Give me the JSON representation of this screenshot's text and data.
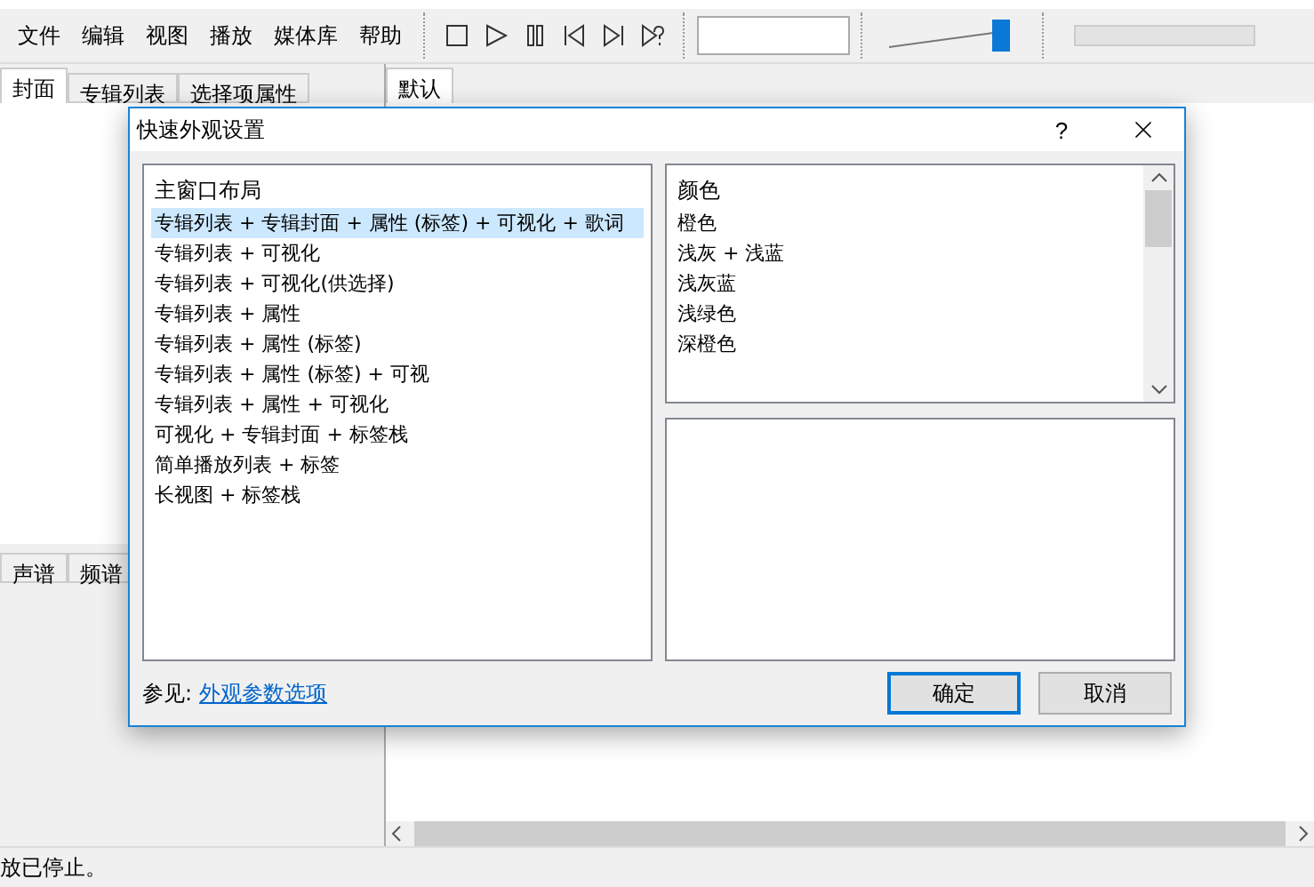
{
  "menu": [
    "文件",
    "编辑",
    "视图",
    "播放",
    "媒体库",
    "帮助"
  ],
  "volume": {
    "level": 0.93
  },
  "left_tabs": [
    {
      "label": "封面",
      "selected": true
    },
    {
      "label": "专辑列表",
      "selected": false
    },
    {
      "label": "选择项属性",
      "selected": false
    }
  ],
  "right_tabs": [
    {
      "label": "默认",
      "selected": true
    }
  ],
  "visual_tabs": [
    {
      "label": "声谱",
      "selected": false
    },
    {
      "label": "频谱",
      "selected": false
    }
  ],
  "status_bar": "放已停止。",
  "dialog": {
    "title": "快速外观设置",
    "help": "?",
    "layouts": {
      "heading": "主窗口布局",
      "items": [
        {
          "label": "专辑列表 + 专辑封面 + 属性 (标签) + 可视化 + 歌词",
          "selected": true
        },
        {
          "label": "专辑列表 + 可视化",
          "selected": false
        },
        {
          "label": "专辑列表 + 可视化(供选择)",
          "selected": false
        },
        {
          "label": "专辑列表 + 属性",
          "selected": false
        },
        {
          "label": "专辑列表 + 属性 (标签)",
          "selected": false
        },
        {
          "label": "专辑列表 + 属性 (标签) + 可视",
          "selected": false
        },
        {
          "label": "专辑列表 + 属性 + 可视化",
          "selected": false
        },
        {
          "label": "可视化 + 专辑封面 + 标签栈",
          "selected": false
        },
        {
          "label": "简单播放列表 + 标签",
          "selected": false
        },
        {
          "label": "长视图 + 标签栈",
          "selected": false
        }
      ]
    },
    "colors": {
      "heading": "颜色",
      "items": [
        {
          "label": "橙色",
          "selected": false
        },
        {
          "label": "浅灰 + 浅蓝",
          "selected": false
        },
        {
          "label": "浅灰蓝",
          "selected": false
        },
        {
          "label": "浅绿色",
          "selected": false
        },
        {
          "label": "深橙色",
          "selected": false
        }
      ]
    },
    "see_also": "参见:",
    "link": "外观参数选项",
    "buttons": [
      {
        "label": "确定",
        "default": true
      },
      {
        "label": "取消",
        "default": false
      }
    ]
  }
}
